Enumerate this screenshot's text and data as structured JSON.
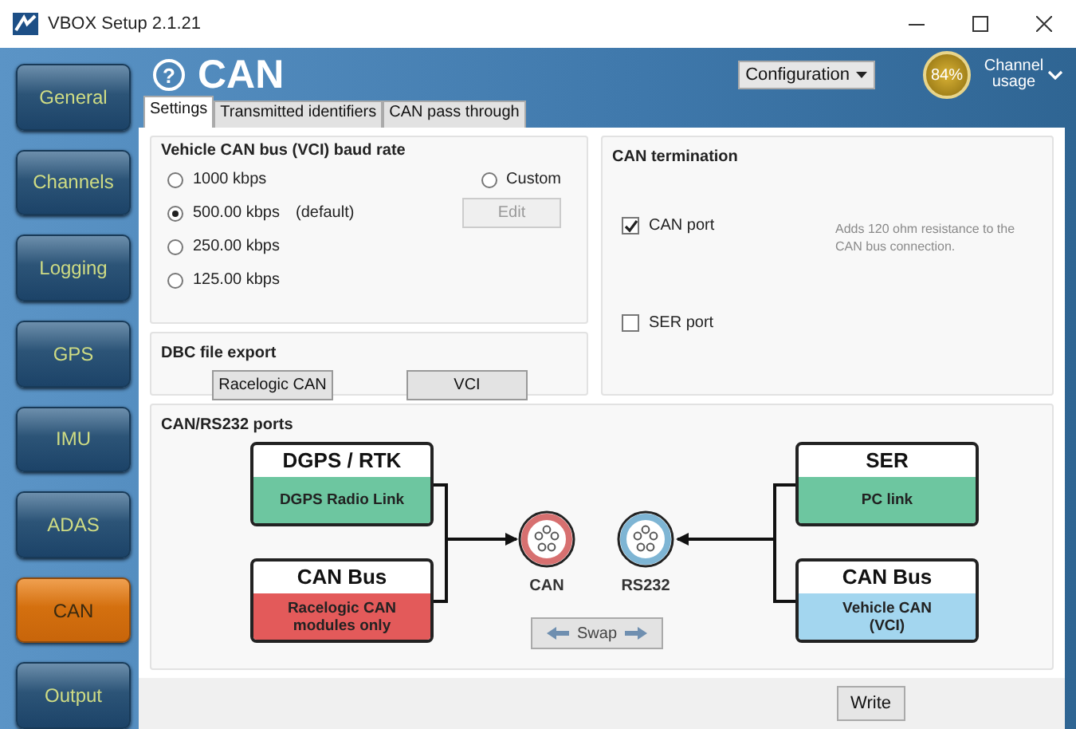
{
  "window": {
    "title": "VBOX Setup 2.1.21"
  },
  "sidebar": {
    "items": [
      {
        "label": "General",
        "selected": false
      },
      {
        "label": "Channels",
        "selected": false
      },
      {
        "label": "Logging",
        "selected": false
      },
      {
        "label": "GPS",
        "selected": false
      },
      {
        "label": "IMU",
        "selected": false
      },
      {
        "label": "ADAS",
        "selected": false
      },
      {
        "label": "CAN",
        "selected": true
      },
      {
        "label": "Output",
        "selected": false
      }
    ]
  },
  "header": {
    "title": "CAN",
    "help": "?",
    "configuration": "Configuration",
    "channel_usage": {
      "reading": "84%",
      "label": "Channel usage"
    }
  },
  "tabs": [
    {
      "label": "Settings",
      "selected": true
    },
    {
      "label": "Transmitted identifiers",
      "selected": false
    },
    {
      "label": "CAN pass through",
      "selected": false
    }
  ],
  "baud_rate": {
    "title": "Vehicle CAN bus (VCI) baud rate",
    "options": [
      {
        "label": "1000 kbps",
        "selected": false
      },
      {
        "label": "500.00 kbps",
        "note": "(default)",
        "selected": true
      },
      {
        "label": "250.00 kbps",
        "selected": false
      },
      {
        "label": "125.00 kbps",
        "selected": false
      }
    ],
    "custom": {
      "label": "Custom",
      "selected": false
    },
    "edit_button": {
      "label": "Edit",
      "disabled": true
    }
  },
  "dbc_export": {
    "title": "DBC file export",
    "buttons": [
      "Racelogic CAN",
      "VCI"
    ]
  },
  "termination": {
    "title": "CAN termination",
    "checkboxes": [
      {
        "label": "CAN port",
        "checked": true
      },
      {
        "label": "SER port",
        "checked": false
      }
    ],
    "note": "Adds 120 ohm resistance to the CAN bus connection."
  },
  "ports": {
    "title": "CAN/RS232 ports",
    "left": [
      {
        "title": "DGPS / RTK",
        "lines": [
          "DGPS Radio Link"
        ],
        "color": "#6dc6a0"
      },
      {
        "title": "CAN Bus",
        "lines": [
          "Racelogic CAN",
          "modules only"
        ],
        "color": "#e35a5a"
      }
    ],
    "connectors": [
      {
        "label": "CAN",
        "color": "#d77070"
      },
      {
        "label": "RS232",
        "color": "#7eb5d4"
      }
    ],
    "right": [
      {
        "title": "SER",
        "lines": [
          "PC link"
        ],
        "color": "#6dc6a0"
      },
      {
        "title": "CAN Bus",
        "lines": [
          "Vehicle CAN",
          "(VCI)"
        ],
        "color": "#a3d6ef"
      }
    ],
    "swap_button": "Swap"
  },
  "footer": {
    "write_button": "Write"
  }
}
